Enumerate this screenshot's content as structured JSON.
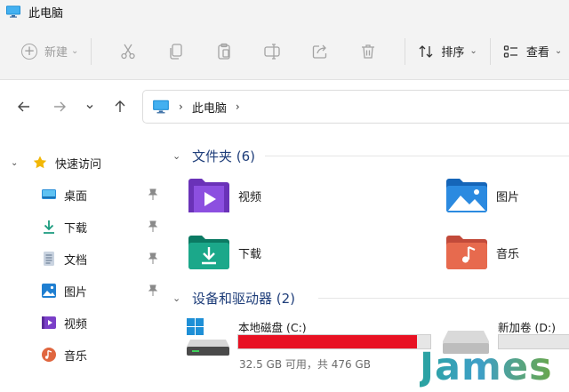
{
  "window": {
    "title": "此电脑"
  },
  "toolbar": {
    "new_label": "新建",
    "sort_label": "排序",
    "view_label": "查看"
  },
  "address": {
    "location": "此电脑"
  },
  "sidebar": {
    "items": [
      {
        "label": "快速访问",
        "icon": "star-icon"
      },
      {
        "label": "桌面",
        "icon": "desktop-icon"
      },
      {
        "label": "下载",
        "icon": "download-icon"
      },
      {
        "label": "文档",
        "icon": "document-icon"
      },
      {
        "label": "图片",
        "icon": "pictures-icon"
      },
      {
        "label": "视频",
        "icon": "videos-icon"
      },
      {
        "label": "音乐",
        "icon": "music-icon"
      }
    ]
  },
  "main": {
    "folders_group": "文件夹 (6)",
    "folders": [
      {
        "label": "视频",
        "icon": "videos-folder-icon"
      },
      {
        "label": "图片",
        "icon": "pictures-folder-icon"
      },
      {
        "label": "下载",
        "icon": "downloads-folder-icon"
      },
      {
        "label": "音乐",
        "icon": "music-folder-icon"
      }
    ],
    "drives_group": "设备和驱动器 (2)",
    "drives": [
      {
        "name": "本地磁盘 (C:)",
        "size_text": "32.5 GB 可用，共 476 GB",
        "used_fraction": 0.932
      },
      {
        "name": "新加卷 (D:)"
      }
    ]
  },
  "watermark": {
    "text": "James"
  },
  "colors": {
    "accent": "#0067c0",
    "drive_full": "#e81123",
    "group_header": "#1f3e7a"
  }
}
